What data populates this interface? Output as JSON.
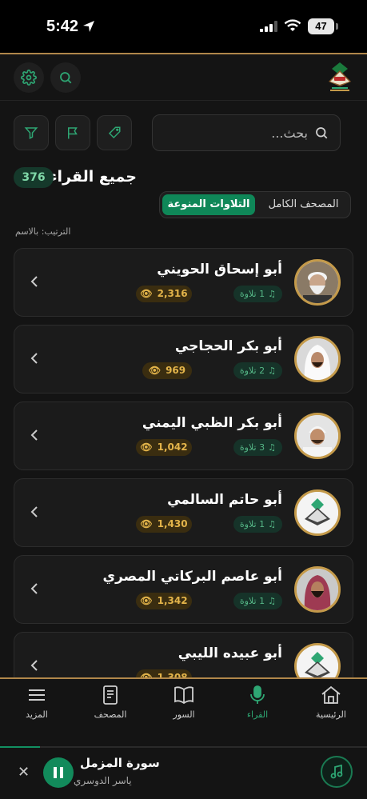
{
  "status_bar": {
    "time": "5:42",
    "battery": "47"
  },
  "search": {
    "placeholder": "بحث..."
  },
  "list_header": {
    "title": "جميع القراء",
    "count": "376"
  },
  "tabs": {
    "full_mushaf": "المصحف الكامل",
    "various": "التلاوات المنوعة"
  },
  "sort_label": "الترتيب: بالاسم",
  "reciters": [
    {
      "name": "أبو إسحاق الحويني",
      "recitations": "1 تلاوة",
      "views": "2,316"
    },
    {
      "name": "أبو بكر الحجاجي",
      "recitations": "2 تلاوة",
      "views": "969"
    },
    {
      "name": "أبو بكر الظبي اليمني",
      "recitations": "3 تلاوة",
      "views": "1,042"
    },
    {
      "name": "أبو حاتم السالمي",
      "recitations": "1 تلاوة",
      "views": "1,430"
    },
    {
      "name": "أبو عاصم البركاتي المصري",
      "recitations": "1 تلاوة",
      "views": "1,342"
    },
    {
      "name": "أبو عبيده الليبي",
      "recitations": "",
      "views": "1,308"
    }
  ],
  "nav": {
    "home": "الرئيسية",
    "reciters": "القراء",
    "surahs": "السور",
    "mushaf": "المصحف",
    "more": "المزيد"
  },
  "player": {
    "title": "سورة المزمل",
    "artist": "ياسر الدوسري",
    "progress": 0.11
  },
  "colors": {
    "accent": "#0f8758",
    "gold": "#b0874a",
    "background": "#141414"
  }
}
